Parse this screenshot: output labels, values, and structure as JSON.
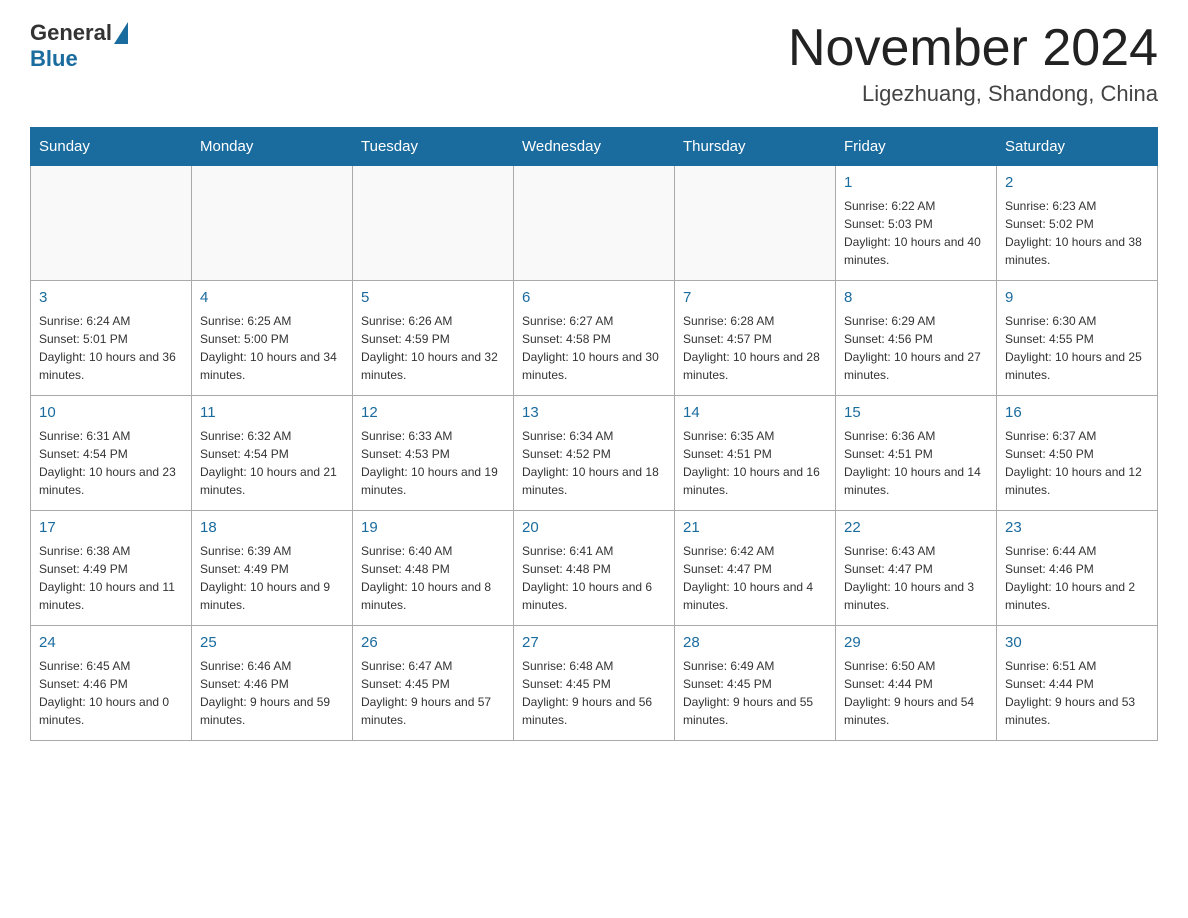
{
  "header": {
    "logo_general": "General",
    "logo_blue": "Blue",
    "month_title": "November 2024",
    "location": "Ligezhuang, Shandong, China"
  },
  "calendar": {
    "days_of_week": [
      "Sunday",
      "Monday",
      "Tuesday",
      "Wednesday",
      "Thursday",
      "Friday",
      "Saturday"
    ],
    "weeks": [
      [
        {
          "day": "",
          "info": ""
        },
        {
          "day": "",
          "info": ""
        },
        {
          "day": "",
          "info": ""
        },
        {
          "day": "",
          "info": ""
        },
        {
          "day": "",
          "info": ""
        },
        {
          "day": "1",
          "info": "Sunrise: 6:22 AM\nSunset: 5:03 PM\nDaylight: 10 hours and 40 minutes."
        },
        {
          "day": "2",
          "info": "Sunrise: 6:23 AM\nSunset: 5:02 PM\nDaylight: 10 hours and 38 minutes."
        }
      ],
      [
        {
          "day": "3",
          "info": "Sunrise: 6:24 AM\nSunset: 5:01 PM\nDaylight: 10 hours and 36 minutes."
        },
        {
          "day": "4",
          "info": "Sunrise: 6:25 AM\nSunset: 5:00 PM\nDaylight: 10 hours and 34 minutes."
        },
        {
          "day": "5",
          "info": "Sunrise: 6:26 AM\nSunset: 4:59 PM\nDaylight: 10 hours and 32 minutes."
        },
        {
          "day": "6",
          "info": "Sunrise: 6:27 AM\nSunset: 4:58 PM\nDaylight: 10 hours and 30 minutes."
        },
        {
          "day": "7",
          "info": "Sunrise: 6:28 AM\nSunset: 4:57 PM\nDaylight: 10 hours and 28 minutes."
        },
        {
          "day": "8",
          "info": "Sunrise: 6:29 AM\nSunset: 4:56 PM\nDaylight: 10 hours and 27 minutes."
        },
        {
          "day": "9",
          "info": "Sunrise: 6:30 AM\nSunset: 4:55 PM\nDaylight: 10 hours and 25 minutes."
        }
      ],
      [
        {
          "day": "10",
          "info": "Sunrise: 6:31 AM\nSunset: 4:54 PM\nDaylight: 10 hours and 23 minutes."
        },
        {
          "day": "11",
          "info": "Sunrise: 6:32 AM\nSunset: 4:54 PM\nDaylight: 10 hours and 21 minutes."
        },
        {
          "day": "12",
          "info": "Sunrise: 6:33 AM\nSunset: 4:53 PM\nDaylight: 10 hours and 19 minutes."
        },
        {
          "day": "13",
          "info": "Sunrise: 6:34 AM\nSunset: 4:52 PM\nDaylight: 10 hours and 18 minutes."
        },
        {
          "day": "14",
          "info": "Sunrise: 6:35 AM\nSunset: 4:51 PM\nDaylight: 10 hours and 16 minutes."
        },
        {
          "day": "15",
          "info": "Sunrise: 6:36 AM\nSunset: 4:51 PM\nDaylight: 10 hours and 14 minutes."
        },
        {
          "day": "16",
          "info": "Sunrise: 6:37 AM\nSunset: 4:50 PM\nDaylight: 10 hours and 12 minutes."
        }
      ],
      [
        {
          "day": "17",
          "info": "Sunrise: 6:38 AM\nSunset: 4:49 PM\nDaylight: 10 hours and 11 minutes."
        },
        {
          "day": "18",
          "info": "Sunrise: 6:39 AM\nSunset: 4:49 PM\nDaylight: 10 hours and 9 minutes."
        },
        {
          "day": "19",
          "info": "Sunrise: 6:40 AM\nSunset: 4:48 PM\nDaylight: 10 hours and 8 minutes."
        },
        {
          "day": "20",
          "info": "Sunrise: 6:41 AM\nSunset: 4:48 PM\nDaylight: 10 hours and 6 minutes."
        },
        {
          "day": "21",
          "info": "Sunrise: 6:42 AM\nSunset: 4:47 PM\nDaylight: 10 hours and 4 minutes."
        },
        {
          "day": "22",
          "info": "Sunrise: 6:43 AM\nSunset: 4:47 PM\nDaylight: 10 hours and 3 minutes."
        },
        {
          "day": "23",
          "info": "Sunrise: 6:44 AM\nSunset: 4:46 PM\nDaylight: 10 hours and 2 minutes."
        }
      ],
      [
        {
          "day": "24",
          "info": "Sunrise: 6:45 AM\nSunset: 4:46 PM\nDaylight: 10 hours and 0 minutes."
        },
        {
          "day": "25",
          "info": "Sunrise: 6:46 AM\nSunset: 4:46 PM\nDaylight: 9 hours and 59 minutes."
        },
        {
          "day": "26",
          "info": "Sunrise: 6:47 AM\nSunset: 4:45 PM\nDaylight: 9 hours and 57 minutes."
        },
        {
          "day": "27",
          "info": "Sunrise: 6:48 AM\nSunset: 4:45 PM\nDaylight: 9 hours and 56 minutes."
        },
        {
          "day": "28",
          "info": "Sunrise: 6:49 AM\nSunset: 4:45 PM\nDaylight: 9 hours and 55 minutes."
        },
        {
          "day": "29",
          "info": "Sunrise: 6:50 AM\nSunset: 4:44 PM\nDaylight: 9 hours and 54 minutes."
        },
        {
          "day": "30",
          "info": "Sunrise: 6:51 AM\nSunset: 4:44 PM\nDaylight: 9 hours and 53 minutes."
        }
      ]
    ]
  }
}
